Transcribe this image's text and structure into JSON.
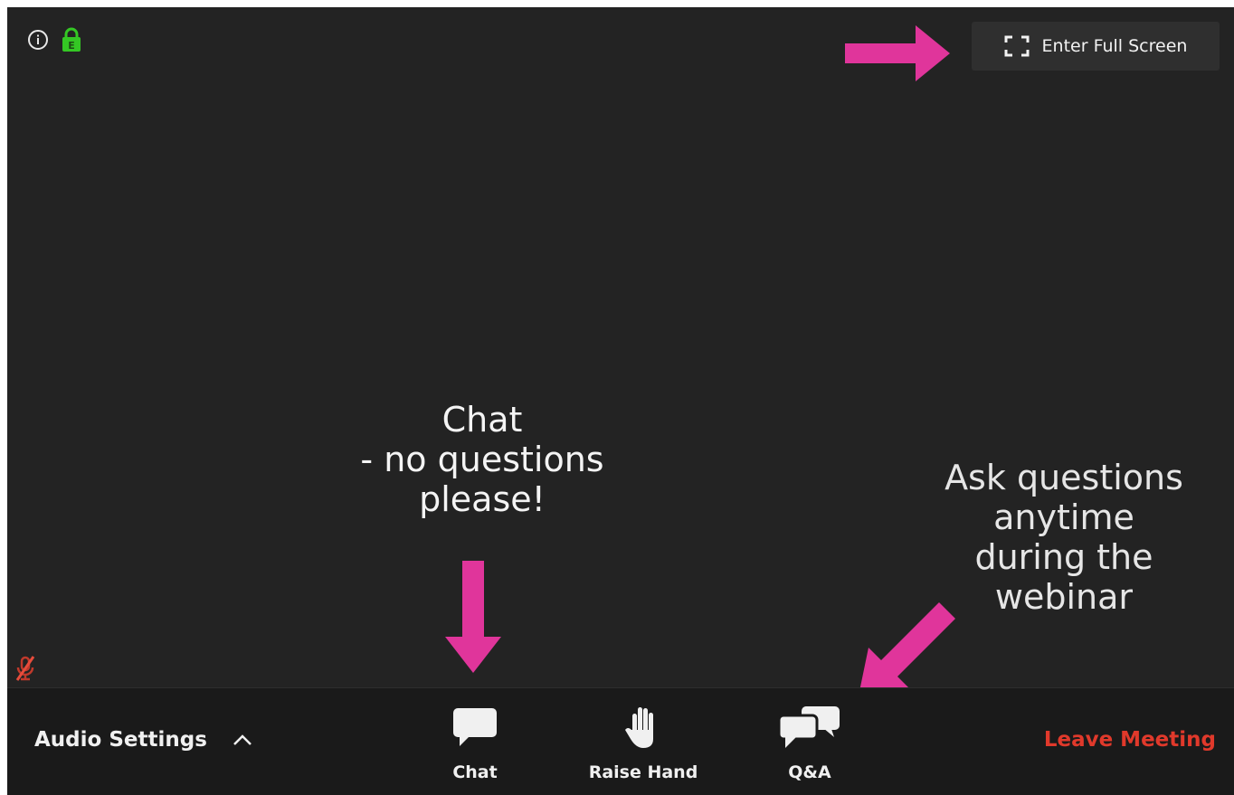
{
  "topbar": {
    "icons": [
      "info-icon",
      "encryption-lock-icon"
    ],
    "lock_letter": "E",
    "fullscreen_label": "Enter Full Screen"
  },
  "annotations": {
    "chat_note": "Chat\n- no questions\nplease!",
    "qa_note": "Ask questions\nanytime\nduring the\nwebinar"
  },
  "toolbar": {
    "audio_settings_label": "Audio Settings",
    "chat_label": "Chat",
    "raise_hand_label": "Raise Hand",
    "qa_label": "Q&A",
    "leave_label": "Leave Meeting"
  },
  "colors": {
    "background": "#232323",
    "toolbar": "#1a1a1a",
    "accent_arrow": "#e0359b",
    "leave_red": "#e0392b",
    "lock_green": "#34c724"
  }
}
